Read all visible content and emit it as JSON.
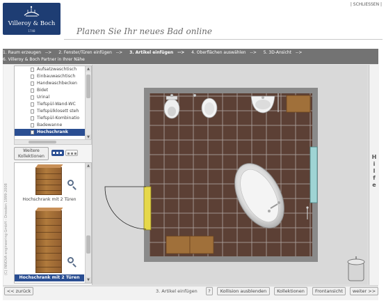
{
  "brand": {
    "name": "Villeroy & Boch",
    "year": "1748"
  },
  "header": {
    "close_label": "| SCHLIESSEN |",
    "tagline": "Planen Sie Ihr neues Bad online"
  },
  "steps": [
    {
      "label": "1. Raum erzeugen",
      "arrow": "-->"
    },
    {
      "label": "2. Fenster/Türen einfügen",
      "arrow": "-->"
    },
    {
      "label": "3. Artikel einfügen",
      "arrow": "-->",
      "active": true
    },
    {
      "label": "4. Oberflächen auswählen",
      "arrow": "-->"
    },
    {
      "label": "5. 3D-Ansicht",
      "arrow": "-->"
    },
    {
      "label": "6. Villeroy & Boch Partner in Ihrer Nähe",
      "arrow": ""
    }
  ],
  "sidebar": {
    "categories": [
      {
        "label": "Aufsatzwaschtisch"
      },
      {
        "label": "Einbauwaschtisch"
      },
      {
        "label": "Handwaschbecken"
      },
      {
        "label": "Bidet"
      },
      {
        "label": "Urinal"
      },
      {
        "label": "Tiefspül-Wand-WC"
      },
      {
        "label": "Tiefspülklosett steh"
      },
      {
        "label": "Tiefspül-Kombinatio"
      },
      {
        "label": "Badewanne"
      },
      {
        "label": "Hochschrank",
        "selected": true
      }
    ],
    "more_button_line1": "Weitere",
    "more_button_line2": "Kollektionen",
    "copyright": "(C) INNOVA engineering GmbH - Dresden 1999-2008",
    "products": [
      {
        "label": "Hochschrank mit 2 Türen"
      },
      {
        "label": "Hochschrank mit 2 Türen",
        "selected": true
      }
    ]
  },
  "canvas": {
    "fixtures": [
      "bidet",
      "toilet",
      "washbasin",
      "vanity",
      "cabinet",
      "bathtub",
      "shower-mixer",
      "door",
      "window",
      "trash-can"
    ]
  },
  "help": {
    "letters": [
      "H",
      "i",
      "l",
      "f",
      "e"
    ]
  },
  "footer": {
    "back_label": "<< zurück",
    "step_info": "3. Artikel einfügen",
    "help_button": "?",
    "collision_button": "Kollision ausblenden",
    "collections_button": "Kollektionen",
    "front_view_button": "Frontansicht",
    "next_label": "weiter >>"
  },
  "colors": {
    "brand_blue": "#1e3d73",
    "selection_blue": "#2a4e92",
    "step_bar": "#737373",
    "floor_tile": "#5c4035",
    "wall": "#8a8a8a",
    "wood": "#a0703a",
    "door_frame": "#e6d84a",
    "window": "#9fd4d4"
  }
}
